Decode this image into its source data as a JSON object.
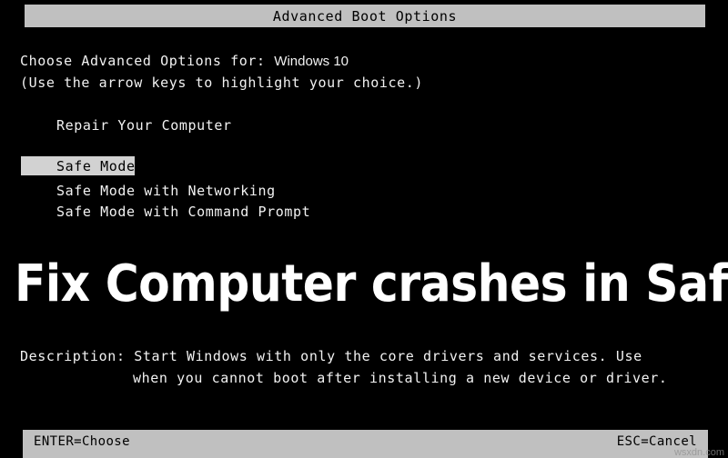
{
  "window": {
    "title": "Advanced Boot Options"
  },
  "prompt": {
    "line1_prefix": "Choose Advanced Options for: ",
    "os_name": "Windows 10",
    "line2": "(Use the arrow keys to highlight your choice.)"
  },
  "menu": {
    "items": [
      {
        "label": "Repair Your Computer",
        "selected": false
      },
      {
        "label": "Safe Mode",
        "selected": true
      },
      {
        "label": "Safe Mode with Networking",
        "selected": false
      },
      {
        "label": "Safe Mode with Command Prompt",
        "selected": false
      }
    ]
  },
  "overlay": {
    "headline": "Fix Computer crashes in Safe Mode"
  },
  "description": {
    "line1": "Description: Start Windows with only the core drivers and services. Use",
    "line2": "when you cannot boot after installing a new device or driver."
  },
  "footer": {
    "enter_label": "ENTER=Choose",
    "esc_label": "ESC=Cancel",
    "watermark": "wsxdn.com"
  },
  "colors": {
    "background": "#000000",
    "bar_background": "#c0c0c0",
    "highlight_background": "#d2d2d2",
    "console_text": "#f2f2f2",
    "bar_text": "#000000",
    "overlay_text": "#ffffff"
  }
}
